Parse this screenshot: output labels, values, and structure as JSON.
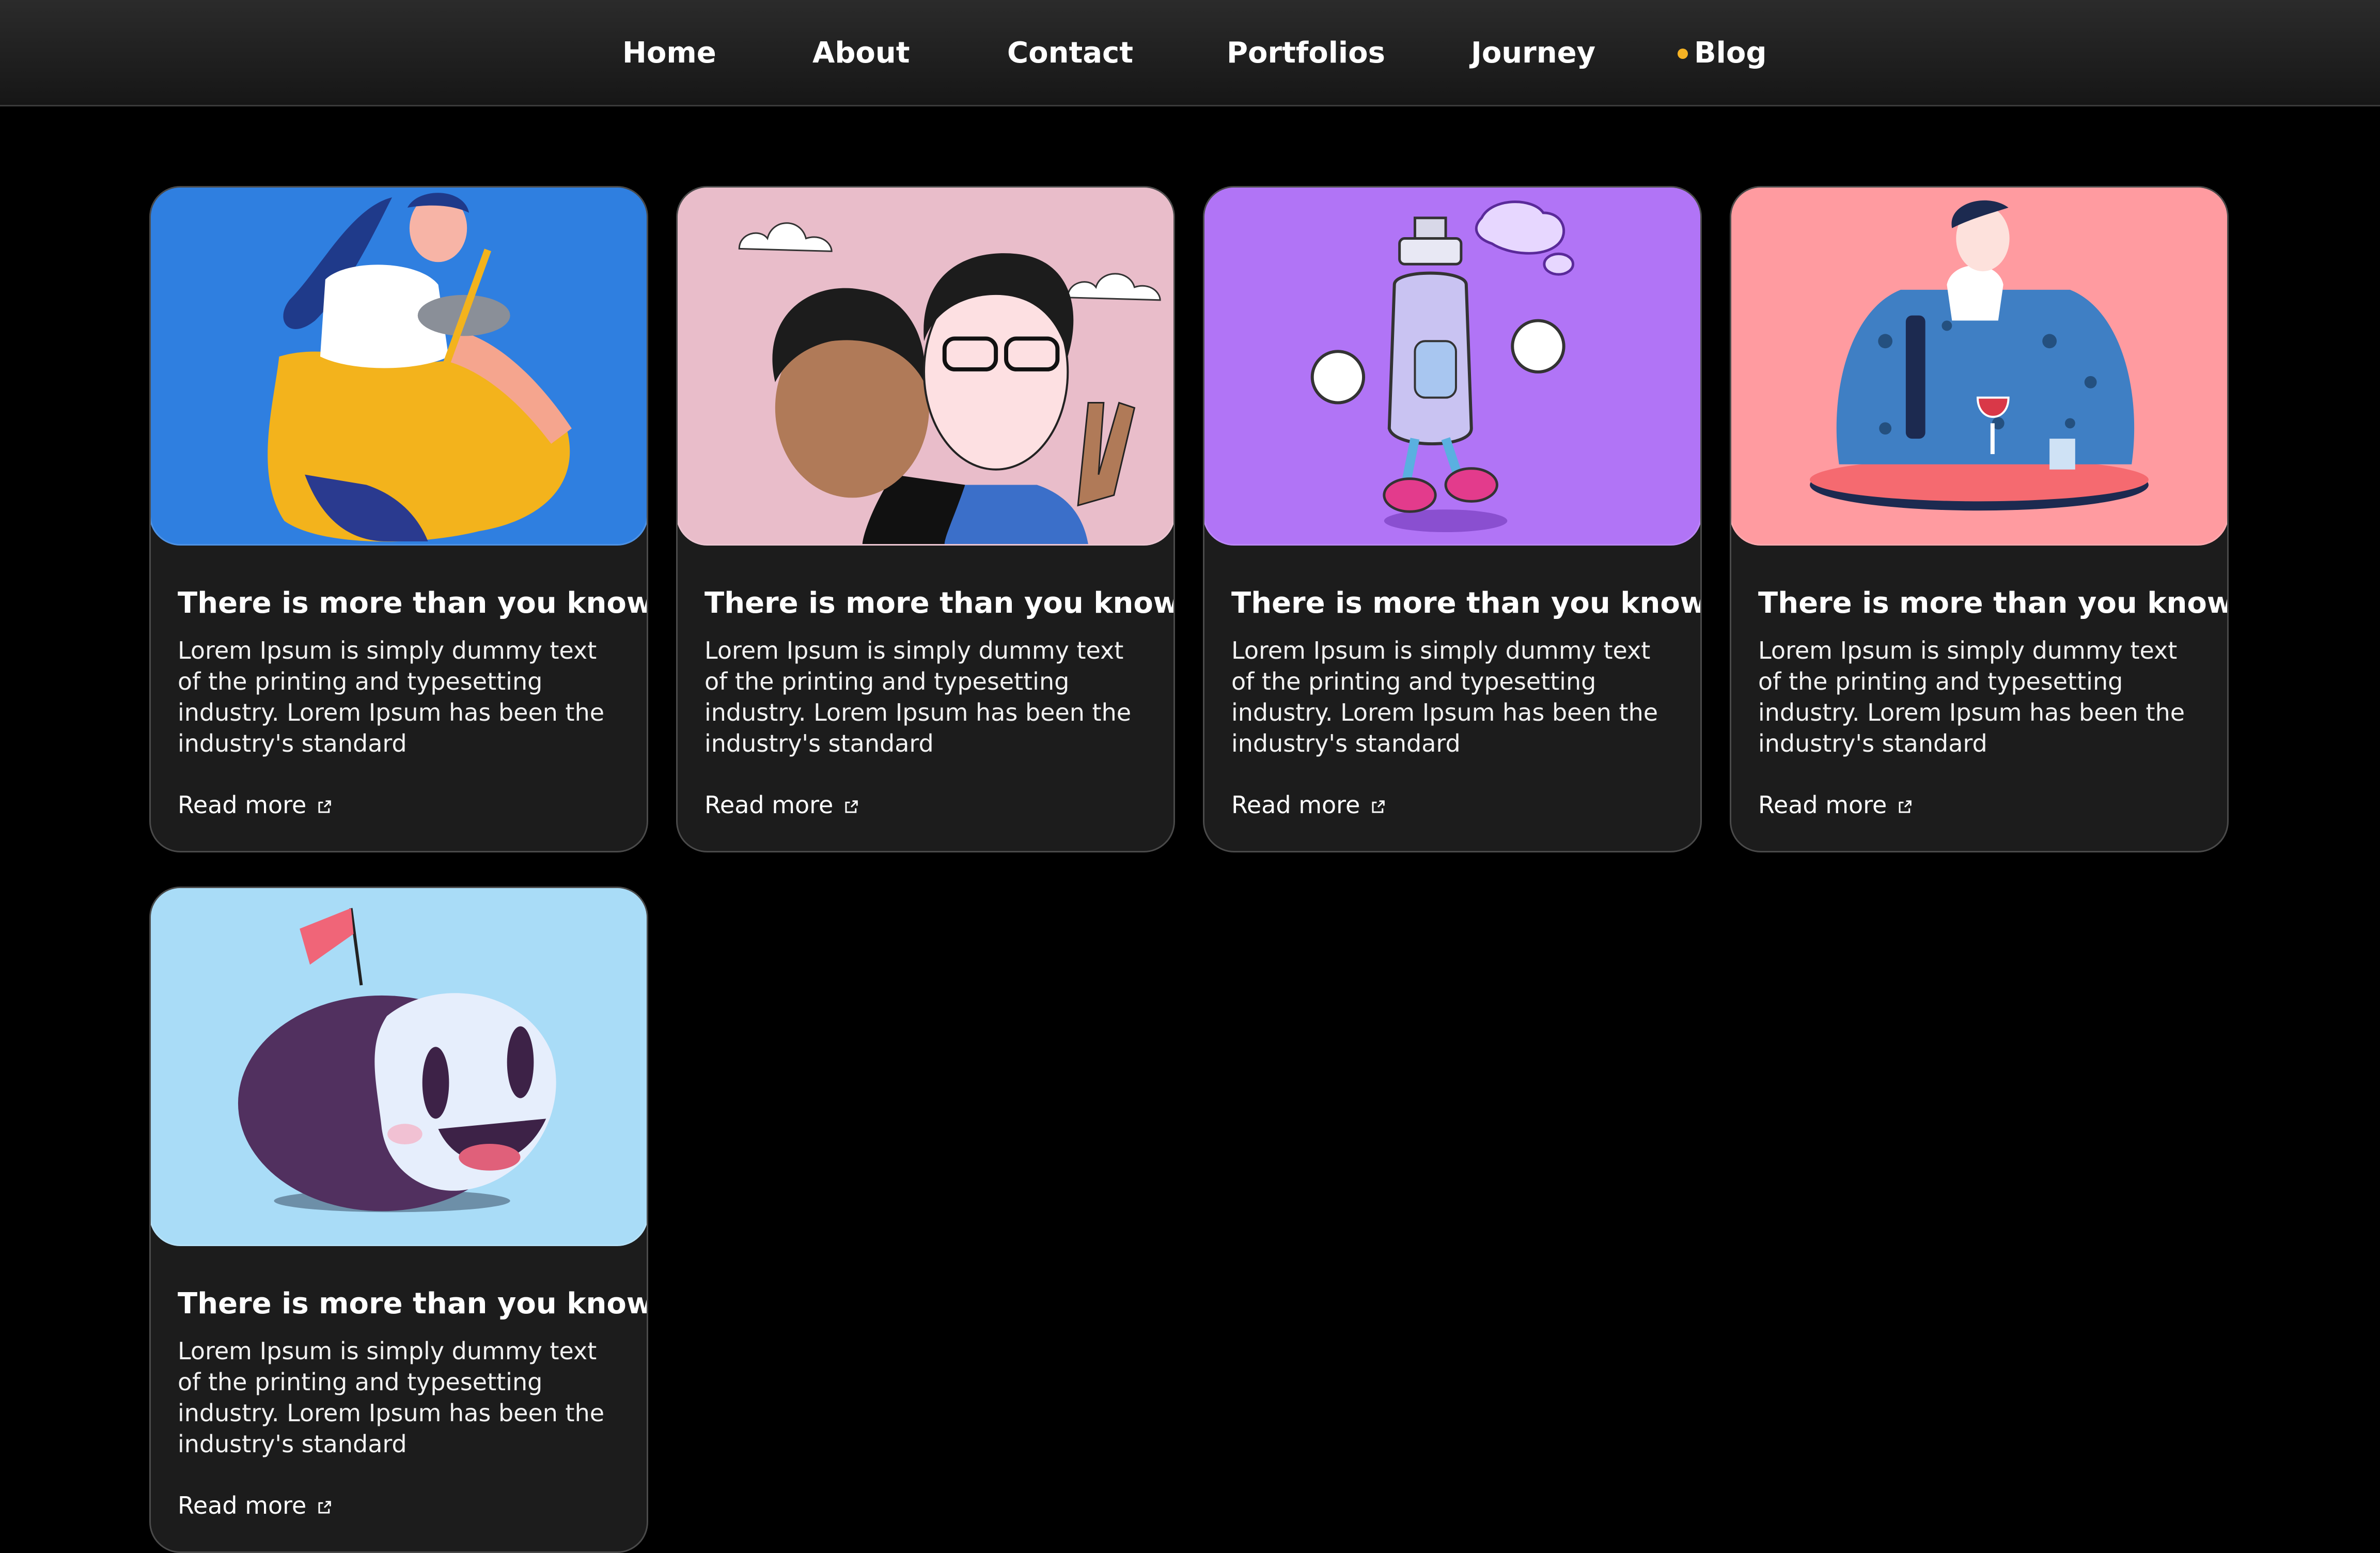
{
  "nav": {
    "items": [
      {
        "label": "Home"
      },
      {
        "label": "About"
      },
      {
        "label": "Contact"
      },
      {
        "label": "Portfolios"
      },
      {
        "label": "Journey"
      },
      {
        "label": "Blog",
        "active": true
      }
    ],
    "active_indicator_color": "#f6b324"
  },
  "cards": [
    {
      "illustration": "woman-with-cat-illustration",
      "background": "#2f7fe0",
      "title": "There is more than you know",
      "text": "Lorem Ipsum is simply dummy text of the printing and typesetting industry. Lorem Ipsum has been the industry's standard",
      "link": "Read more",
      "link_icon": "external-link-icon"
    },
    {
      "illustration": "couple-selfie-illustration",
      "background": "#e9bdca",
      "title": "There is more than you know",
      "text": "Lorem Ipsum is simply dummy text of the printing and typesetting industry. Lorem Ipsum has been the industry's standard",
      "link": "Read more",
      "link_icon": "external-link-icon"
    },
    {
      "illustration": "soap-bottle-character-illustration",
      "background": "#b174f6",
      "title": "There is more than you know",
      "text": "Lorem Ipsum is simply dummy text of the printing and typesetting industry. Lorem Ipsum has been the industry's standard",
      "link": "Read more",
      "link_icon": "external-link-icon"
    },
    {
      "illustration": "person-with-wine-illustration",
      "background": "#ff9ba0",
      "title": "There is more than you know",
      "text": "Lorem Ipsum is simply dummy text of the printing and typesetting industry. Lorem Ipsum has been the industry's standard",
      "link": "Read more",
      "link_icon": "external-link-icon"
    },
    {
      "illustration": "smiling-ball-character-illustration",
      "background": "#a9dcf7",
      "title": "There is more than you know",
      "text": "Lorem Ipsum is simply dummy text of the printing and typesetting industry. Lorem Ipsum has been the industry's standard",
      "link": "Read more",
      "link_icon": "external-link-icon"
    }
  ]
}
